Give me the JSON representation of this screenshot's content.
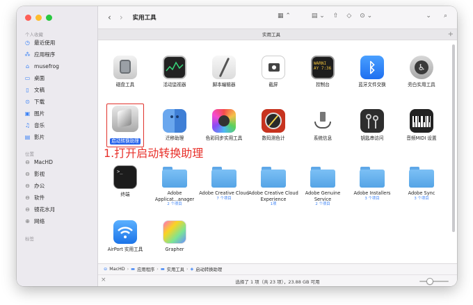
{
  "window": {
    "title": "实用工具",
    "tab_label": "实用工具"
  },
  "traffic_colors": [
    "#fe5f57",
    "#febc2e",
    "#28c840"
  ],
  "sidebar": {
    "favorites_title": "个人收藏",
    "favorites": [
      {
        "label": "最近使用",
        "icon": "clock-icon"
      },
      {
        "label": "应用程序",
        "icon": "apps-icon"
      },
      {
        "label": "musefrog",
        "icon": "home-icon"
      },
      {
        "label": "桌面",
        "icon": "desktop-icon"
      },
      {
        "label": "文稿",
        "icon": "document-icon"
      },
      {
        "label": "下载",
        "icon": "download-icon"
      },
      {
        "label": "图片",
        "icon": "photo-icon"
      },
      {
        "label": "音乐",
        "icon": "music-icon"
      },
      {
        "label": "影片",
        "icon": "film-icon"
      }
    ],
    "locations_title": "位置",
    "locations": [
      {
        "label": "MacHD",
        "icon": "disk-icon"
      },
      {
        "label": "影视",
        "icon": "disk-icon"
      },
      {
        "label": "办公",
        "icon": "disk-icon"
      },
      {
        "label": "软件",
        "icon": "disk-icon"
      },
      {
        "label": "镜花水月",
        "icon": "disk-icon"
      },
      {
        "label": "网络",
        "icon": "network-icon"
      }
    ],
    "tags_title": "标签"
  },
  "toolbar": {
    "back": "‹",
    "forward": "›",
    "search_icon": "⌕"
  },
  "items": [
    {
      "label": "磁盘工具",
      "sub": ""
    },
    {
      "label": "活动监视器",
      "sub": ""
    },
    {
      "label": "脚本编辑器",
      "sub": ""
    },
    {
      "label": "截屏",
      "sub": ""
    },
    {
      "label": "控制台",
      "sub": ""
    },
    {
      "label": "蓝牙文件交换",
      "sub": ""
    },
    {
      "label": "旁白实用工具",
      "sub": ""
    },
    {
      "label": "启动转换助理",
      "sub": ""
    },
    {
      "label": "迁移助理",
      "sub": ""
    },
    {
      "label": "色彩同步实用工具",
      "sub": ""
    },
    {
      "label": "数码测色计",
      "sub": ""
    },
    {
      "label": "系统信息",
      "sub": ""
    },
    {
      "label": "钥匙串访问",
      "sub": ""
    },
    {
      "label": "音频MIDI 设置",
      "sub": ""
    },
    {
      "label": "终端",
      "sub": ""
    },
    {
      "label": "Adobe Applicat...anager",
      "sub": "2 个项目"
    },
    {
      "label": "Adobe Creative Cloud",
      "sub": "7 个项目"
    },
    {
      "label": "Adobe Creative Cloud Experience",
      "sub": "1项"
    },
    {
      "label": "Adobe Genuine Service",
      "sub": "2 个项目"
    },
    {
      "label": "Adobe Installers",
      "sub": "3 个项目"
    },
    {
      "label": "Adobe Sync",
      "sub": "3 个项目"
    },
    {
      "label": "AirPort 实用工具",
      "sub": ""
    },
    {
      "label": "Grapher",
      "sub": ""
    }
  ],
  "console_text": "WARNI\nAY 7:36",
  "annotation": "1.打开启动转换助理",
  "pathbar": [
    "MacHD",
    "应用程序",
    "实用工具",
    "启动转换助理"
  ],
  "status": "选择了 1 项（共 23 项），23.88 GB 可用"
}
